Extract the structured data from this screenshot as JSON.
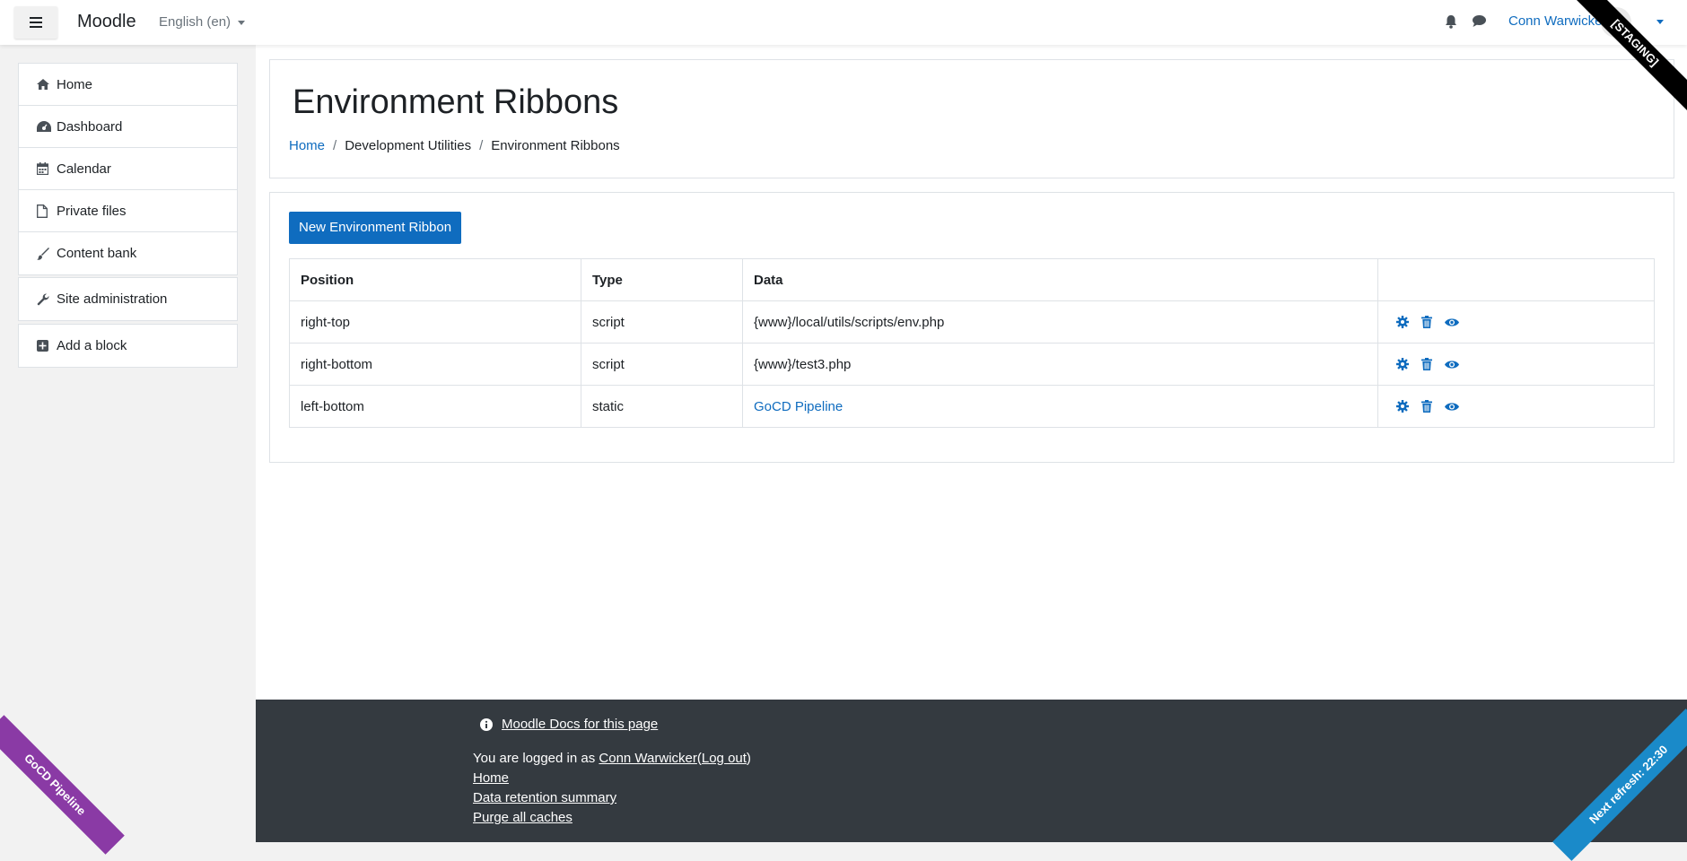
{
  "navbar": {
    "brand": "Moodle",
    "language": "English (en)",
    "user_name": "Conn Warwicker"
  },
  "ribbons": {
    "staging": "[STAGING]",
    "gocd": "GoCD Pipeline",
    "refresh": "Next refresh: 22:30"
  },
  "sidebar": {
    "items": [
      {
        "label": "Home",
        "icon": "home-icon"
      },
      {
        "label": "Dashboard",
        "icon": "dashboard-icon"
      },
      {
        "label": "Calendar",
        "icon": "calendar-icon"
      },
      {
        "label": "Private files",
        "icon": "file-icon"
      },
      {
        "label": "Content bank",
        "icon": "brush-icon"
      }
    ],
    "admin": {
      "label": "Site administration",
      "icon": "wrench-icon"
    },
    "add_block": {
      "label": "Add a block",
      "icon": "plus-square-icon"
    }
  },
  "header": {
    "title": "Environment Ribbons",
    "breadcrumb": [
      "Home",
      "Development Utilities",
      "Environment Ribbons"
    ]
  },
  "content": {
    "new_button": "New Environment Ribbon",
    "columns": [
      "Position",
      "Type",
      "Data",
      ""
    ],
    "rows": [
      {
        "position": "right-top",
        "type": "script",
        "data": "{www}/local/utils/scripts/env.php"
      },
      {
        "position": "right-bottom",
        "type": "script",
        "data": "{www}/test3.php"
      },
      {
        "position": "left-bottom",
        "type": "static",
        "data": "GoCD Pipeline"
      }
    ]
  },
  "footer": {
    "docs_link": "Moodle Docs for this page",
    "logged_in_prefix": "You are logged in as",
    "user_name": "Conn Warwicker",
    "logout_open": "(",
    "logout": "Log out",
    "logout_close": ")",
    "home": "Home",
    "data_retention": "Data retention summary",
    "purge": "Purge all caches"
  },
  "colors": {
    "accent": "#0f6cbf",
    "footer_bg": "#343a40",
    "staging_ribbon": "#000000",
    "gocd_ribbon": "#8a3aa5",
    "refresh_ribbon": "#1a8ac9"
  }
}
